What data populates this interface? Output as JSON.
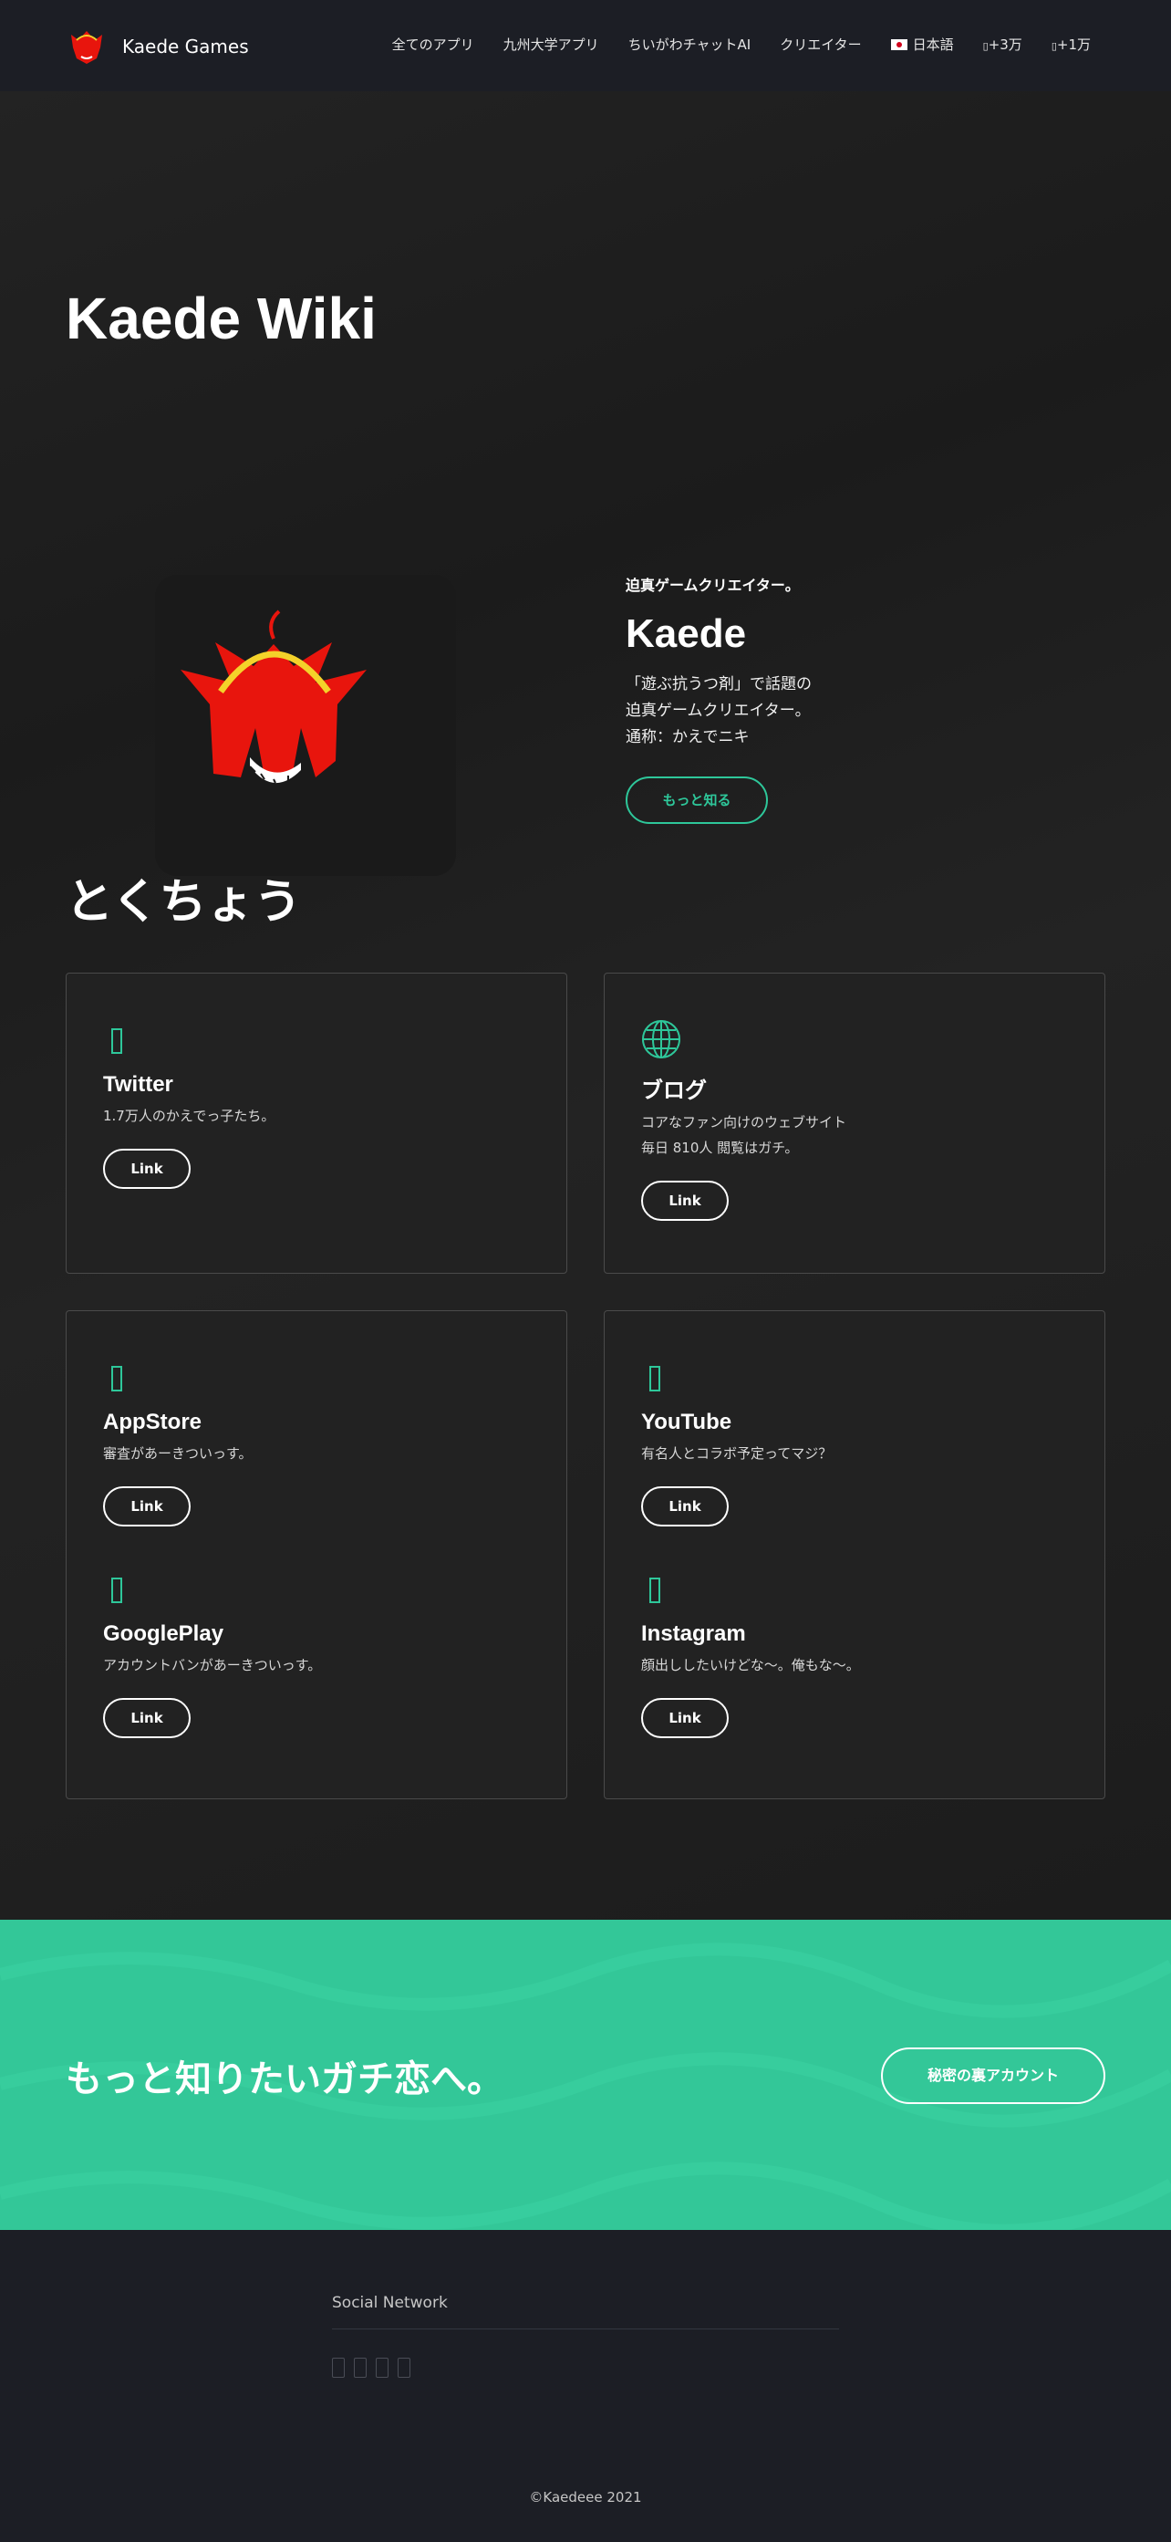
{
  "colors": {
    "accent": "#2ec79a",
    "cta_bg": "#33c798",
    "mascot_red": "#e8150d",
    "halo": "#f4d22a"
  },
  "nav": {
    "brand": "Kaede Games",
    "items": [
      "全てのアプリ",
      "九州大学アプリ",
      "ちいがわチャットAI",
      "クリエイター",
      "日本語",
      "+3万",
      "+1万"
    ]
  },
  "hero": {
    "title": "Kaede Wiki"
  },
  "intro": {
    "kicker": "迫真ゲームクリエイター。",
    "name": "Kaede",
    "desc_lines": [
      "「遊ぶ抗うつ剤」で話題の",
      "迫真ゲームクリエイター。",
      "通称：かえでニキ"
    ],
    "button": "もっと知る"
  },
  "features": {
    "title": "とくちょう",
    "items": [
      {
        "icon": "twitter-icon",
        "title": "Twitter",
        "desc": [
          "1.7万人のかえでっ子たち。"
        ],
        "button": "Link"
      },
      {
        "icon": "globe-icon",
        "title": "ブログ",
        "desc": [
          "コアなファン向けのウェブサイト",
          "毎日 810人 閲覧はガチ。"
        ],
        "button": "Link"
      },
      {
        "icon": "appstore-icon",
        "title": "AppStore",
        "desc": [
          "審査があーきついっす。"
        ],
        "button": "Link"
      },
      {
        "icon": "youtube-icon",
        "title": "YouTube",
        "desc": [
          "有名人とコラボ予定ってマジ？"
        ],
        "button": "Link"
      },
      {
        "icon": "googleplay-icon",
        "title": "GooglePlay",
        "desc": [
          "アカウントバンがあーきついっす。"
        ],
        "button": "Link"
      },
      {
        "icon": "instagram-icon",
        "title": "Instagram",
        "desc": [
          "顔出ししたいけどな〜。俺もな〜。"
        ],
        "button": "Link"
      }
    ]
  },
  "cta": {
    "text": "もっと知りたいガチ恋へ。",
    "button": "秘密の裏アカウント"
  },
  "footer": {
    "heading": "Social Network",
    "copyright": "©Kaedeee 2021"
  }
}
